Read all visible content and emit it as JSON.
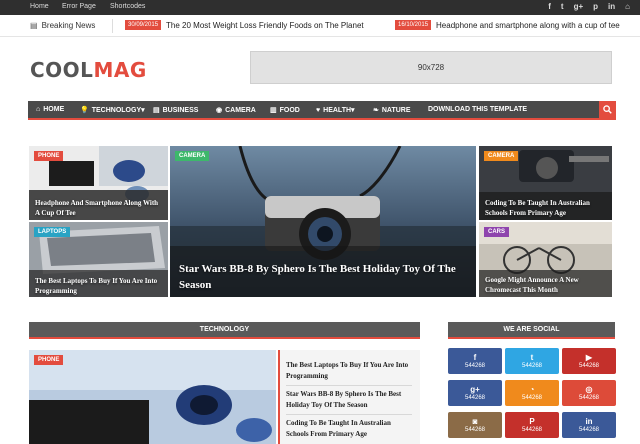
{
  "topbar": {
    "links": [
      "Home",
      "Error Page",
      "Shortcodes"
    ],
    "social_icons": [
      "f",
      "t",
      "g+",
      "p",
      "in",
      "⌂"
    ]
  },
  "breaking": {
    "label": "Breaking News",
    "items": [
      {
        "date": "30/09/2015",
        "title": "The 20 Most Weight Loss Friendly Foods on The Planet"
      },
      {
        "date": "16/10/2015",
        "title": "Headphone and smartphone along with a cup of tee"
      }
    ]
  },
  "header": {
    "logo_part1": "COOL",
    "logo_part2": "MAG",
    "ad_text": "90x728"
  },
  "nav": {
    "items": [
      {
        "icon": "⌂",
        "label": "HOME"
      },
      {
        "icon": "💡",
        "label": "TECHNOLOGY▾"
      },
      {
        "icon": "▤",
        "label": "BUSINESS"
      },
      {
        "icon": "◉",
        "label": "CAMERA"
      },
      {
        "icon": "▥",
        "label": "FOOD"
      },
      {
        "icon": "♥",
        "label": "HEALTH▾"
      },
      {
        "icon": "❧",
        "label": "NATURE"
      },
      {
        "icon": "",
        "label": "DOWNLOAD THIS TEMPLATE"
      }
    ]
  },
  "featured": {
    "left_top": {
      "category": "PHONE",
      "title": "Headphone And Smartphone Along With A Cup Of Tee"
    },
    "left_bottom": {
      "category": "LAPTOPS",
      "title": "The Best Laptops To Buy If You Are Into Programming"
    },
    "center": {
      "category": "CAMERA",
      "title": "Star Wars BB-8 By Sphero Is The Best Holiday Toy Of The Season"
    },
    "right_top": {
      "category": "CAMERA",
      "title": "Coding To Be Taught In Australian Schools From Primary Age"
    },
    "right_bottom": {
      "category": "CARS",
      "title": "Google Might Announce A New Chromecast This Month"
    }
  },
  "technology": {
    "heading": "TECHNOLOGY",
    "main_category": "PHONE",
    "list": [
      "The Best Laptops To Buy If You Are Into Programming",
      "Star Wars BB-8 By Sphero Is The Best Holiday Toy Of The Season",
      "Coding To Be Taught In Australian Schools From Primary Age"
    ]
  },
  "social": {
    "heading": "WE ARE SOCIAL",
    "buttons": [
      {
        "icon": "f",
        "count": "544268",
        "color": "#3b5998",
        "name": "facebook"
      },
      {
        "icon": "t",
        "count": "544268",
        "color": "#2fa6e3",
        "name": "twitter"
      },
      {
        "icon": "▶",
        "count": "544268",
        "color": "#c4302b",
        "name": "youtube"
      },
      {
        "icon": "g+",
        "count": "544268",
        "color": "#3b5998",
        "name": "googleplus"
      },
      {
        "icon": "◔",
        "count": "544268",
        "color": "#f08a1c",
        "name": "rss"
      },
      {
        "icon": "◎",
        "count": "544268",
        "color": "#dd4b39",
        "name": "dribbble"
      },
      {
        "icon": "◙",
        "count": "544268",
        "color": "#8b6b47",
        "name": "instagram"
      },
      {
        "icon": "P",
        "count": "544268",
        "color": "#c4302b",
        "name": "pinterest"
      },
      {
        "icon": "in",
        "count": "544268",
        "color": "#3b5998",
        "name": "linkedin"
      }
    ]
  },
  "colors": {
    "accent": "#e34c3e",
    "dark": "#2f2f2f",
    "nav": "#4a4a4a",
    "camera_green": "#3db86b",
    "cars_purple": "#8e44ad",
    "laptops_teal": "#29a3c4",
    "camera_orange": "#f08a1c"
  }
}
